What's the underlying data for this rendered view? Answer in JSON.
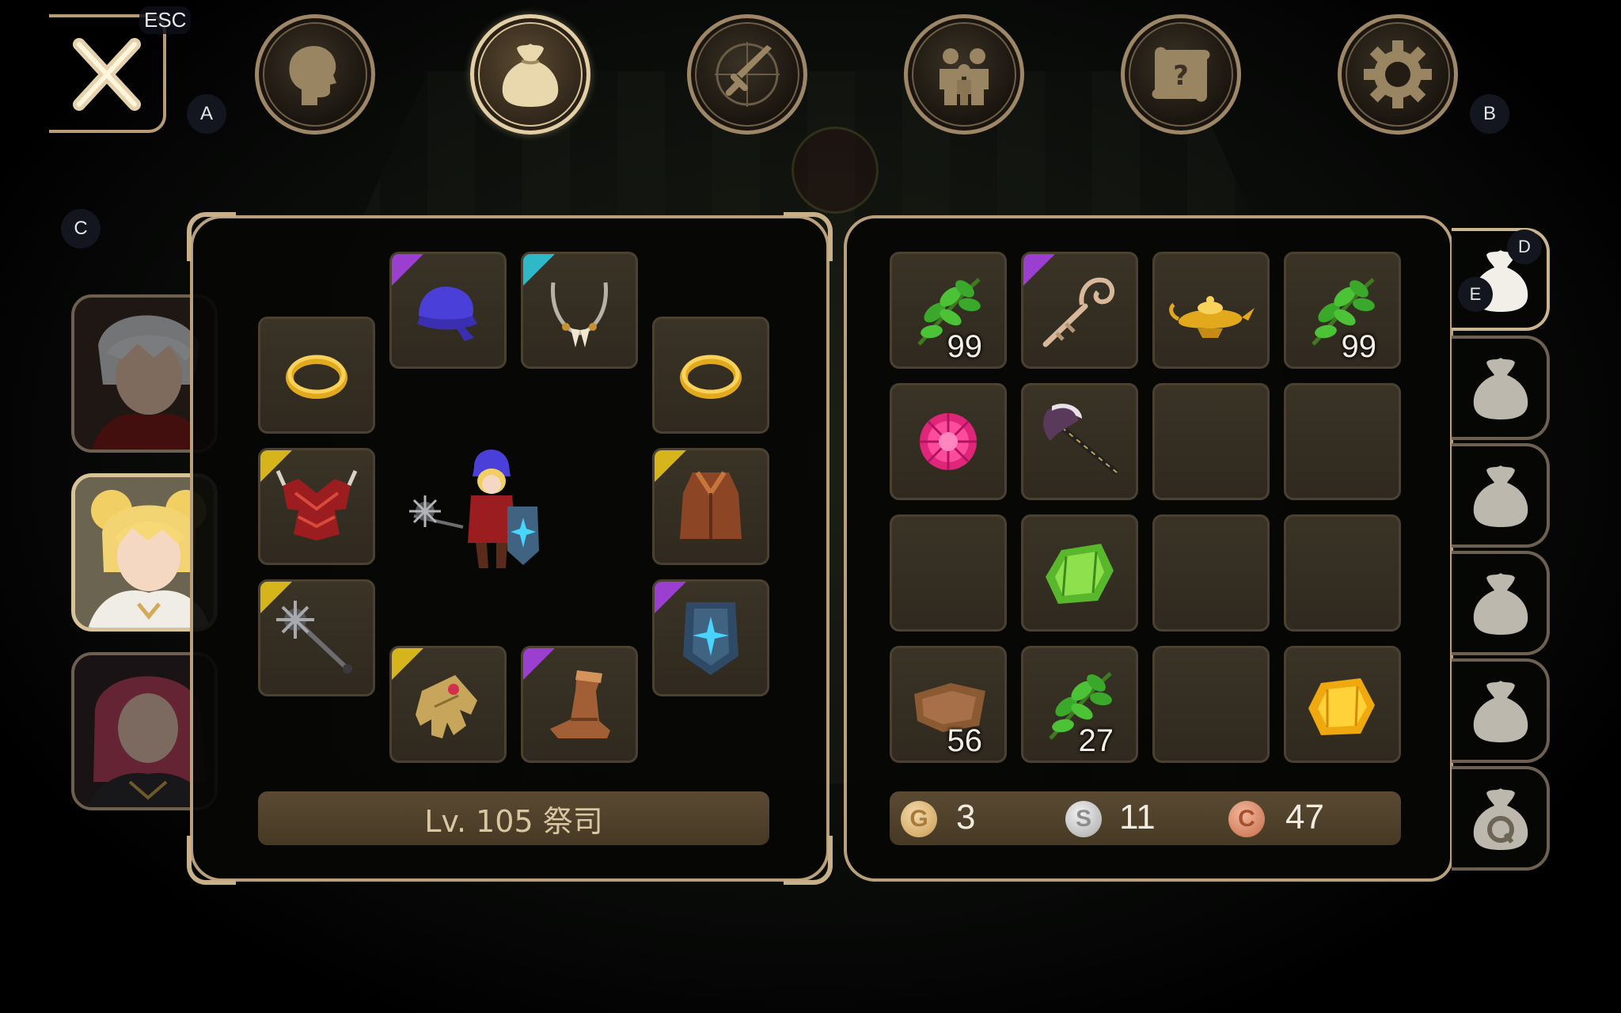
{
  "top_bar": {
    "close_key": "ESC",
    "key_a": "A",
    "key_b": "B",
    "tabs": [
      {
        "icon": "character-head-icon",
        "active": false
      },
      {
        "icon": "bag-icon",
        "active": true
      },
      {
        "icon": "skill-sword-icon",
        "active": false
      },
      {
        "icon": "party-icon",
        "active": false
      },
      {
        "icon": "quest-scroll-icon",
        "active": false
      },
      {
        "icon": "settings-gear-icon",
        "active": false
      }
    ]
  },
  "party": {
    "key_c": "C",
    "members": [
      {
        "name": "white-haired-warrior",
        "active": false
      },
      {
        "name": "blonde-priest",
        "active": true
      },
      {
        "name": "red-haired-mage",
        "active": false
      }
    ]
  },
  "equipment": {
    "level_text": "Lv. 105 祭司",
    "slots": [
      {
        "name": "ring-left",
        "icon": "gold-ring-icon",
        "rarity": ""
      },
      {
        "name": "head",
        "icon": "blue-hat-icon",
        "rarity": "#9b3fd0"
      },
      {
        "name": "necklace",
        "icon": "fang-necklace-icon",
        "rarity": "#2fb8c8"
      },
      {
        "name": "ring-right",
        "icon": "gold-ring-icon",
        "rarity": ""
      },
      {
        "name": "armor",
        "icon": "red-armor-icon",
        "rarity": "#d6b41c"
      },
      {
        "name": "cloak",
        "icon": "brown-robe-icon",
        "rarity": "#d6b41c"
      },
      {
        "name": "weapon",
        "icon": "morning-star-icon",
        "rarity": "#d6b41c"
      },
      {
        "name": "shield",
        "icon": "crystal-shield-icon",
        "rarity": "#9b3fd0"
      },
      {
        "name": "gloves",
        "icon": "gold-glove-icon",
        "rarity": "#d6b41c"
      },
      {
        "name": "boots",
        "icon": "leather-boot-icon",
        "rarity": "#9b3fd0"
      }
    ]
  },
  "inventory": {
    "key_d": "D",
    "key_e": "E",
    "slots": [
      {
        "icon": "herb-leaf-icon",
        "qty": "99",
        "rarity": ""
      },
      {
        "icon": "bone-staff-icon",
        "qty": "",
        "rarity": "#9b3fd0"
      },
      {
        "icon": "magic-lamp-icon",
        "qty": "",
        "rarity": ""
      },
      {
        "icon": "herb-leaf-icon",
        "qty": "99",
        "rarity": ""
      },
      {
        "icon": "pink-gem-icon",
        "qty": "",
        "rarity": ""
      },
      {
        "icon": "battle-axe-icon",
        "qty": "",
        "rarity": ""
      },
      {
        "icon": "",
        "qty": "",
        "rarity": ""
      },
      {
        "icon": "",
        "qty": "",
        "rarity": ""
      },
      {
        "icon": "",
        "qty": "",
        "rarity": ""
      },
      {
        "icon": "green-gem-icon",
        "qty": "",
        "rarity": ""
      },
      {
        "icon": "",
        "qty": "",
        "rarity": ""
      },
      {
        "icon": "",
        "qty": "",
        "rarity": ""
      },
      {
        "icon": "leather-scrap-icon",
        "qty": "56",
        "rarity": ""
      },
      {
        "icon": "herb-leaf-icon",
        "qty": "27",
        "rarity": ""
      },
      {
        "icon": "",
        "qty": "",
        "rarity": ""
      },
      {
        "icon": "yellow-gem-icon",
        "qty": "",
        "rarity": ""
      }
    ],
    "currency": {
      "gold": {
        "letter": "G",
        "value": "3"
      },
      "silver": {
        "letter": "S",
        "value": "11"
      },
      "copper": {
        "letter": "C",
        "value": "47"
      }
    },
    "bag_tabs": [
      {
        "icon": "bag-icon",
        "active": true
      },
      {
        "icon": "bag-icon",
        "active": false
      },
      {
        "icon": "bag-icon",
        "active": false
      },
      {
        "icon": "bag-icon",
        "active": false
      },
      {
        "icon": "bag-icon",
        "active": false
      },
      {
        "icon": "quest-bag-icon",
        "active": false
      }
    ]
  },
  "colors": {
    "frame": "#b9a07a",
    "slot_bg": "#342d22",
    "rarity_epic": "#9b3fd0",
    "rarity_legend": "#d6b41c",
    "rarity_rare": "#2fb8c8"
  }
}
